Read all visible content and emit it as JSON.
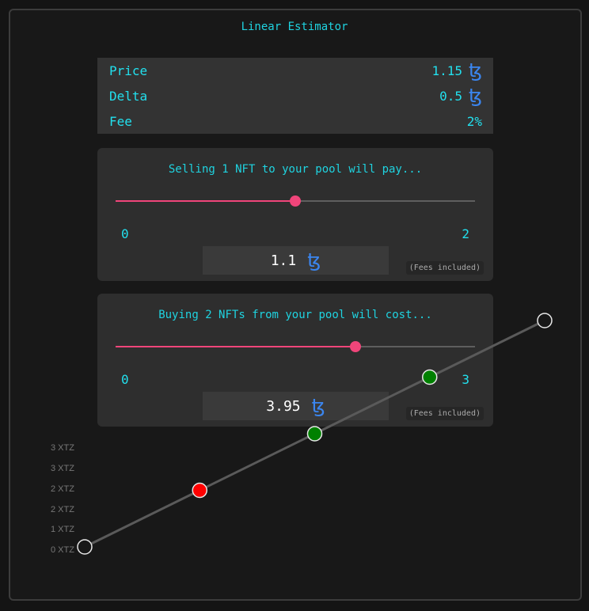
{
  "title": "Linear Estimator",
  "params": {
    "price_label": "Price",
    "price_value": "1.15",
    "delta_label": "Delta",
    "delta_value": "0.5",
    "fee_label": "Fee",
    "fee_value": "2%"
  },
  "currency_symbol": "ꜩ",
  "sell": {
    "heading": "Selling 1 NFT to your pool will pay...",
    "min": "0",
    "max": "2",
    "slider_value": 1,
    "slider_max": 2,
    "amount": "1.1",
    "fees_note": "(Fees included)"
  },
  "buy": {
    "heading": "Buying 2 NFTs from your pool will cost...",
    "min": "0",
    "max": "3",
    "slider_value": 2,
    "slider_max": 3,
    "amount": "3.95",
    "fees_note": "(Fees included)"
  },
  "colors": {
    "accent": "#1fd3e0",
    "slider": "#f0457a",
    "tez": "#3b86f0",
    "sell_point": "#ff0000",
    "buy_point": "#008000"
  },
  "chart_data": {
    "type": "line",
    "y_tick_labels": [
      "0 XTZ",
      "1 XTZ",
      "2 XTZ",
      "2 XTZ",
      "3 XTZ",
      "3 XTZ"
    ],
    "ylim": [
      0,
      3
    ],
    "x": [
      0,
      1,
      2,
      3,
      4
    ],
    "series": [
      {
        "values": [
          0.15,
          0.65,
          1.15,
          1.65,
          2.15
        ]
      }
    ],
    "point_styles": [
      "hollow",
      "sell",
      "buy",
      "buy",
      "hollow"
    ]
  }
}
